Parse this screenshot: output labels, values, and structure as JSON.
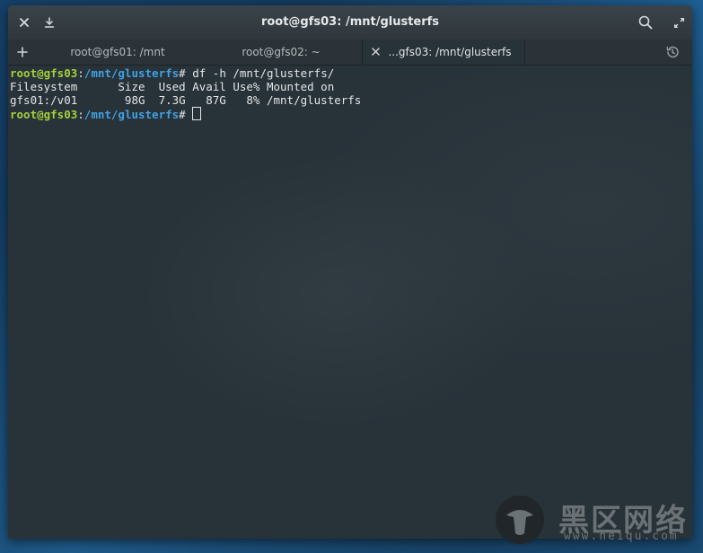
{
  "window": {
    "title": "root@gfs03: /mnt/glusterfs"
  },
  "tabs": [
    {
      "label": "root@gfs01: /mnt",
      "active": false
    },
    {
      "label": "root@gfs02: ~",
      "active": false
    },
    {
      "label": "...gfs03: /mnt/glusterfs",
      "active": true
    }
  ],
  "icons": {
    "close": "close-icon",
    "download": "download-icon",
    "search": "search-icon",
    "maximize": "maximize-icon",
    "new_tab": "plus-icon",
    "history": "history-icon"
  },
  "terminal": {
    "prompt_user": "root@gfs03",
    "prompt_sep": ":",
    "prompt_path": "/mnt/glusterfs",
    "prompt_symbol": "# ",
    "command": "df -h /mnt/glusterfs/",
    "output": [
      "Filesystem      Size  Used Avail Use% Mounted on",
      "gfs01:/v01       98G  7.3G   87G   8% /mnt/glusterfs"
    ]
  },
  "colors": {
    "prompt_user": "#a4d13a",
    "prompt_path": "#41a1e1",
    "terminal_bg": "#283239"
  },
  "watermark": {
    "text": "黑区网络",
    "url": "www.heiqu.com"
  }
}
